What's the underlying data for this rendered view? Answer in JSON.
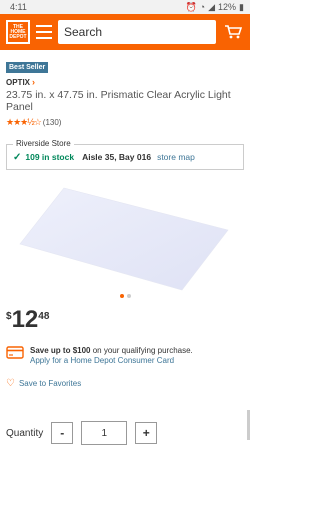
{
  "status_bar": {
    "time": "4:11",
    "battery": "12%"
  },
  "header": {
    "logo_text": "THE HOME DEPOT",
    "search_placeholder": "Search"
  },
  "product": {
    "badge": "Best Seller",
    "brand": "OPTIX",
    "title": "23.75 in. x 47.75 in. Prismatic Clear Acrylic Light Panel",
    "rating_stars": 3.5,
    "review_count": "(130)"
  },
  "store": {
    "legend": "Riverside Store",
    "stock": "109 in stock",
    "aisle": "Aisle 35, Bay 016",
    "map_link": "store map"
  },
  "gallery": {
    "image_count": 2,
    "active_index": 0
  },
  "price": {
    "dollar": "$",
    "whole": "12",
    "cents": "48"
  },
  "credit": {
    "line1_prefix": "Save up to ",
    "line1_amount": "$100",
    "line1_suffix": " on your qualifying purchase.",
    "link": "Apply for a Home Depot Consumer Card"
  },
  "favorites": {
    "label": "Save to Favorites"
  },
  "quantity": {
    "label": "Quantity",
    "minus": "-",
    "value": "1",
    "plus": "+"
  },
  "colors": {
    "brand_orange": "#f96302",
    "link_blue": "#3e7697",
    "stock_green": "#00875a"
  }
}
